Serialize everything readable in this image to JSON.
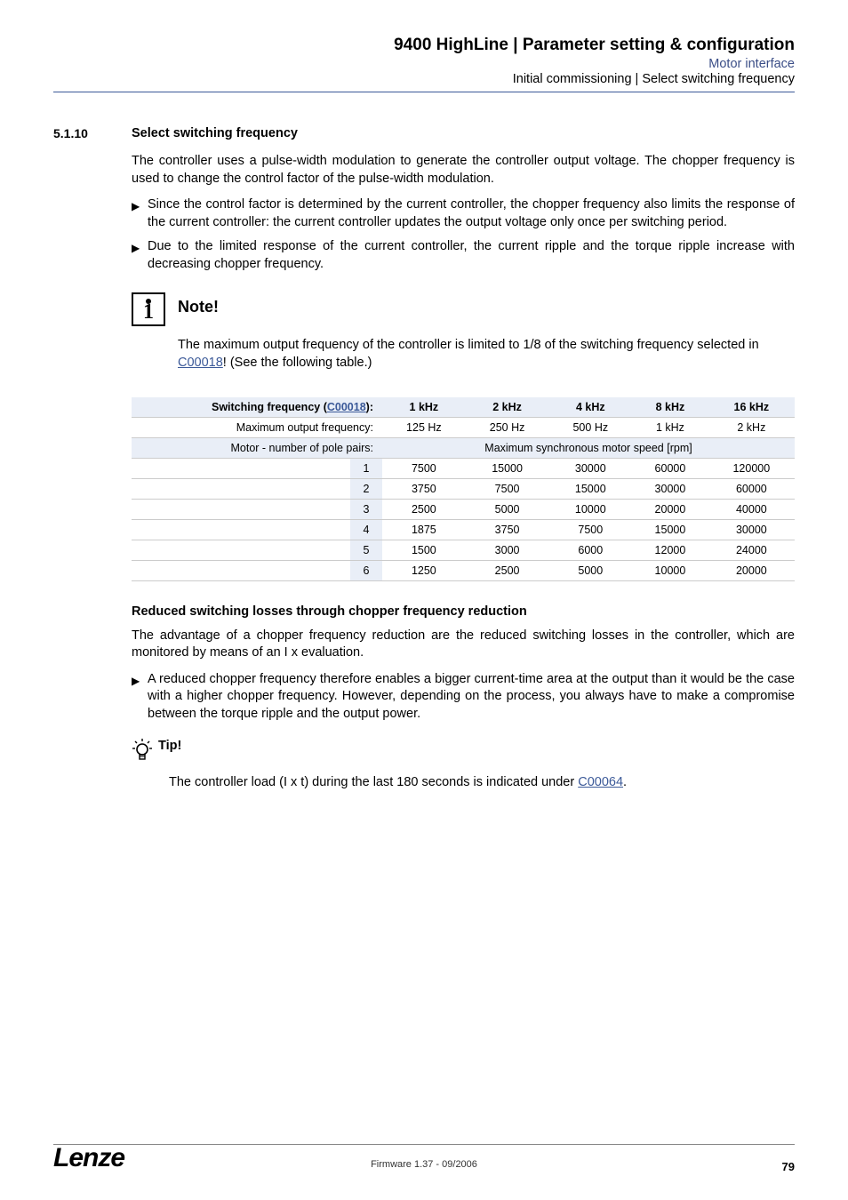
{
  "header": {
    "title": "9400 HighLine | Parameter setting & configuration",
    "sub1": "Motor interface",
    "sub2": "Initial commissioning | Select switching frequency"
  },
  "section": {
    "num": "5.1.10",
    "title": "Select switching frequency"
  },
  "para1": "The controller uses a pulse-width modulation to generate the controller output voltage. The chopper frequency is used to change the control factor of the pulse-width modulation.",
  "bullets1": [
    "Since the control factor is determined by the current controller, the chopper frequency also limits the response of the current controller: the current controller updates the output voltage only once per switching period.",
    "Due to the limited response of the current controller, the current ripple and the torque ripple increase with decreasing chopper frequency."
  ],
  "note": {
    "title": "Note!",
    "text_pre": "The maximum output frequency of the controller is limited to 1/8 of the switching frequency selected in ",
    "link": "C00018",
    "text_post": "! (See the following table.)"
  },
  "table": {
    "hdr_label_pre": "Switching frequency (",
    "hdr_label_link": "C00018",
    "hdr_label_post": "):",
    "cols": [
      "1 kHz",
      "2 kHz",
      "4 kHz",
      "8 kHz",
      "16 kHz"
    ],
    "row_maxfreq_label": "Maximum output frequency:",
    "row_maxfreq": [
      "125 Hz",
      "250 Hz",
      "500 Hz",
      "1 kHz",
      "2 kHz"
    ],
    "row_pairs_label": "Motor - number of pole pairs:",
    "row_pairs_span": "Maximum synchronous motor speed [rpm]",
    "rows": [
      {
        "pp": "1",
        "v": [
          "7500",
          "15000",
          "30000",
          "60000",
          "120000"
        ]
      },
      {
        "pp": "2",
        "v": [
          "3750",
          "7500",
          "15000",
          "30000",
          "60000"
        ]
      },
      {
        "pp": "3",
        "v": [
          "2500",
          "5000",
          "10000",
          "20000",
          "40000"
        ]
      },
      {
        "pp": "4",
        "v": [
          "1875",
          "3750",
          "7500",
          "15000",
          "30000"
        ]
      },
      {
        "pp": "5",
        "v": [
          "1500",
          "3000",
          "6000",
          "12000",
          "24000"
        ]
      },
      {
        "pp": "6",
        "v": [
          "1250",
          "2500",
          "5000",
          "10000",
          "20000"
        ]
      }
    ]
  },
  "chart_data": {
    "type": "table",
    "title": "Maximum synchronous motor speed [rpm] vs switching frequency and pole pairs",
    "column_header_label": "Switching frequency (C00018)",
    "columns": [
      "1 kHz",
      "2 kHz",
      "4 kHz",
      "8 kHz",
      "16 kHz"
    ],
    "max_output_frequency": [
      "125 Hz",
      "250 Hz",
      "500 Hz",
      "1 kHz",
      "2 kHz"
    ],
    "row_header_label": "Motor - number of pole pairs",
    "value_label": "Maximum synchronous motor speed [rpm]",
    "rows": [
      {
        "pole_pairs": 1,
        "values": [
          7500,
          15000,
          30000,
          60000,
          120000
        ]
      },
      {
        "pole_pairs": 2,
        "values": [
          3750,
          7500,
          15000,
          30000,
          60000
        ]
      },
      {
        "pole_pairs": 3,
        "values": [
          2500,
          5000,
          10000,
          20000,
          40000
        ]
      },
      {
        "pole_pairs": 4,
        "values": [
          1875,
          3750,
          7500,
          15000,
          30000
        ]
      },
      {
        "pole_pairs": 5,
        "values": [
          1500,
          3000,
          6000,
          12000,
          24000
        ]
      },
      {
        "pole_pairs": 6,
        "values": [
          1250,
          2500,
          5000,
          10000,
          20000
        ]
      }
    ]
  },
  "subhead": "Reduced switching losses through chopper frequency reduction",
  "para2": "The advantage of a chopper frequency reduction are the reduced switching losses in the controller, which are monitored by means of an I x evaluation.",
  "bullets2": [
    "A reduced chopper frequency therefore enables a bigger current-time area at the output than it would be the case with a higher chopper frequency. However, depending on the process, you always have to make a compromise between the torque ripple and the output power."
  ],
  "tip": {
    "title": "Tip!",
    "text_pre": "The controller load (I x t) during the last 180 seconds is indicated under ",
    "link": "C00064",
    "text_post": "."
  },
  "footer": {
    "logo": "Lenze",
    "center": "Firmware 1.37 - 09/2006",
    "page": "79"
  }
}
